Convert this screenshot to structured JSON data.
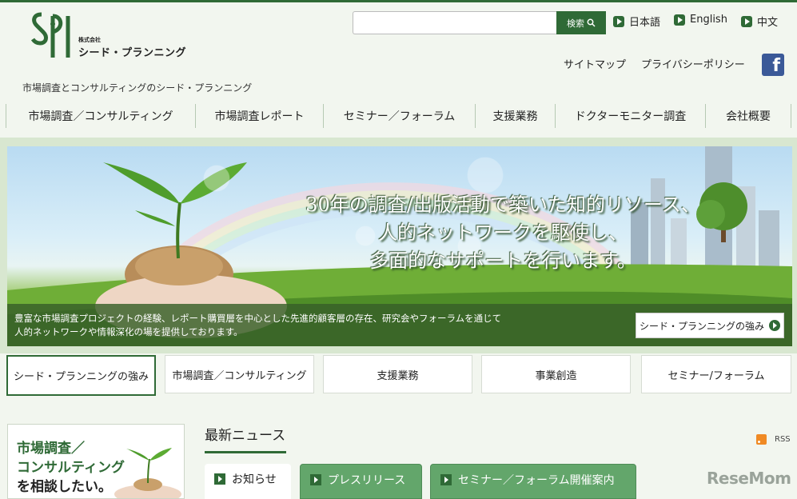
{
  "colors": {
    "brand_green": "#2f6a36",
    "tab_green": "#63a66b",
    "facebook_blue": "#3b5998",
    "rss_orange": "#f08a24"
  },
  "logo": {
    "mark_text": "SPI",
    "small": "株式会社",
    "name": "シード・プランニング"
  },
  "tagline": "市場調査とコンサルティングのシード・プランニング",
  "search": {
    "placeholder": "",
    "button_label": "検索"
  },
  "languages": [
    "日本語",
    "English",
    "中文"
  ],
  "util_links": [
    "サイトマップ",
    "プライバシーポリシー"
  ],
  "facebook": {
    "icon": "facebook-icon",
    "glyph": "f"
  },
  "nav": [
    "市場調査／コンサルティング",
    "市場調査レポート",
    "セミナー／フォーラム",
    "支援業務",
    "ドクターモニター調査",
    "会社概要"
  ],
  "hero": {
    "lines": [
      "30年の調査/出版活動で築いた知的リソース、",
      "人的ネットワークを駆使し、",
      "多面的なサポートを行います。"
    ],
    "description": [
      "豊富な市場調査プロジェクトの経験、レポート購買層を中心とした先進的顧客層の存在、研究会やフォーラムを通じて",
      "人的ネットワークや情報深化の場を提供しております。"
    ],
    "button_label": "シード・プランニングの強み"
  },
  "sub_buttons": [
    "シード・プランニングの強み",
    "市場調査／コンサルティング",
    "支援業務",
    "事業創造",
    "セミナー/フォーラム"
  ],
  "consult_banner": [
    "市場調査／",
    "コンサルティング",
    "を相談したい。"
  ],
  "news": {
    "title": "最新ニュース",
    "rss_label": "RSS",
    "tabs": [
      "お知らせ",
      "プレスリリース",
      "セミナー／フォーラム開催案内"
    ]
  },
  "watermark": "ReseMom"
}
